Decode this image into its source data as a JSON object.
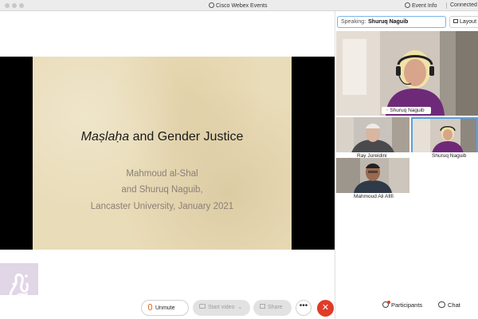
{
  "window": {
    "app_title": "Cisco Webex Events",
    "event_info_label": "Event Info",
    "connection_status": "Connected"
  },
  "slide": {
    "title_italic": "Maṣlaḥa",
    "title_rest": " and Gender Justice",
    "line1": "Mahmoud al-Shal",
    "line2": "and Shuruq Naguib,",
    "line3": "Lancaster University, January 2021"
  },
  "controls": {
    "unmute_label": "Unmute",
    "start_video_label": "Start video",
    "share_label": "Share",
    "more_label": "•••",
    "end_label": "✕"
  },
  "panel": {
    "speaking_label": "Speaking:",
    "speaking_name": "Shuruq Naguib",
    "layout_label": "Layout",
    "main_participant": "Shuruq Naguib",
    "tiles": [
      {
        "name": "Ray Jureidini"
      },
      {
        "name": "Shuruq Naguib"
      },
      {
        "name": "Mahmoud Ali Afifi"
      }
    ],
    "participants_label": "Participants",
    "chat_label": "Chat"
  },
  "colors": {
    "accent": "#5aa0e0",
    "end_call": "#e03c28",
    "slide_bg": "#e9dcb8"
  }
}
